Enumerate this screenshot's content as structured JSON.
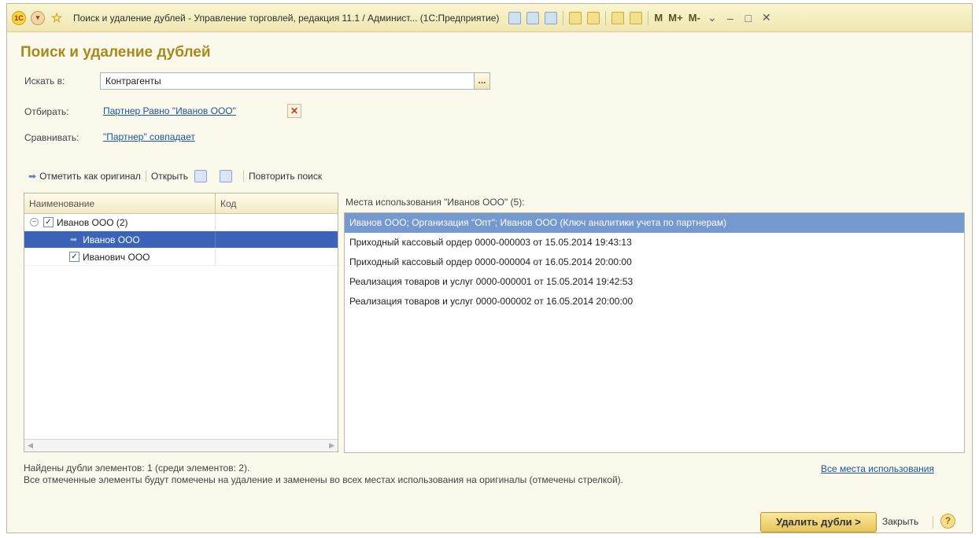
{
  "window": {
    "title": "Поиск и удаление дублей - Управление торговлей, редакция 11.1 / Админист... (1С:Предприятие)",
    "m_buttons": [
      "M",
      "M+",
      "M-"
    ]
  },
  "form": {
    "title": "Поиск и удаление дублей",
    "search_in_label": "Искать в:",
    "search_in_value": "Контрагенты",
    "filter_label": "Отбирать:",
    "filter_link": "Партнер Равно \"Иванов ООО\"",
    "compare_label": "Сравнивать:",
    "compare_link": "\"Партнер\" совпадает"
  },
  "commands": {
    "mark_original": "Отметить как оригинал",
    "open": "Открыть",
    "repeat_search": "Повторить поиск"
  },
  "duplicates": {
    "columns": [
      "Наименование",
      "Код"
    ],
    "rows": [
      {
        "name": "Иванов ООО (2)",
        "code": ""
      },
      {
        "name": "Иванов ООО",
        "code": ""
      },
      {
        "name": "Иванович ООО",
        "code": ""
      }
    ]
  },
  "usages": {
    "title": "Места использования \"Иванов ООО\" (5):",
    "items": [
      "Иванов ООО; Организация \"Опт\"; Иванов ООО (Ключ аналитики учета по партнерам)",
      "Приходный кассовый ордер 0000-000003 от 15.05.2014 19:43:13",
      "Приходный кассовый ордер 0000-000004 от 16.05.2014 20:00:00",
      "Реализация товаров и услуг 0000-000001 от 15.05.2014 19:42:53",
      "Реализация товаров и услуг 0000-000002 от 16.05.2014 20:00:00"
    ]
  },
  "footer": {
    "found": "Найдены дубли элементов: 1 (среди элементов: 2).",
    "note": "Все отмеченные элементы будут помечены на удаление и заменены во всех местах использования на оригиналы (отмечены стрелкой).",
    "all_uses_link": "Все места использования"
  },
  "buttons": {
    "delete": "Удалить дубли >",
    "close": "Закрыть",
    "help": "?"
  }
}
